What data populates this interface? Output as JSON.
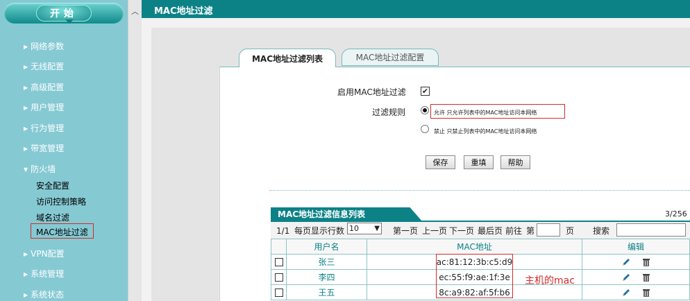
{
  "sidebar": {
    "start_label": "开始",
    "items": [
      {
        "label": "网络参数"
      },
      {
        "label": "无线配置"
      },
      {
        "label": "高级配置"
      },
      {
        "label": "用户管理"
      },
      {
        "label": "行为管理"
      },
      {
        "label": "带宽管理"
      },
      {
        "label": "防火墙"
      },
      {
        "label": "VPN配置"
      },
      {
        "label": "系统管理"
      },
      {
        "label": "系统状态"
      }
    ],
    "firewall_sub": [
      "安全配置",
      "访问控制策略",
      "域名过滤",
      "MAC地址过滤"
    ]
  },
  "header": {
    "title": "MAC地址过滤"
  },
  "tabs": {
    "list": "MAC地址过滤列表",
    "config": "MAC地址过滤配置"
  },
  "form": {
    "enable_label": "启用MAC地址过滤",
    "rule_label": "过滤规则",
    "allow_option": "允许 只允许列表中的MAC地址访问本网络",
    "deny_option": "禁止 只禁止列表中的MAC地址访问本网络",
    "save": "保存",
    "reset": "重填",
    "help": "帮助"
  },
  "list": {
    "title": "MAC地址过滤信息列表",
    "count": "3/256",
    "page": "1/1",
    "per_page_label": "每页显示行数",
    "per_page_value": "10",
    "first": "第一页",
    "prev": "上一页",
    "next": "下一页",
    "last": "最后页",
    "goto": "前往",
    "page_pre": "第",
    "page_post": "页",
    "search": "搜索",
    "columns": [
      "用户名",
      "MAC地址",
      "编辑"
    ],
    "rows": [
      {
        "name": "张三",
        "mac": "ac:81:12:3b:c5:d9"
      },
      {
        "name": "李四",
        "mac": "ec:55:f9:ae:1f:3e"
      },
      {
        "name": "王五",
        "mac": "8c:a9:82:af:5f:b6"
      }
    ]
  },
  "annotation": "主机的mac",
  "colors": {
    "teal": "#0c8287",
    "sidebar": "#85c9d3",
    "highlight": "#d42a2a"
  }
}
